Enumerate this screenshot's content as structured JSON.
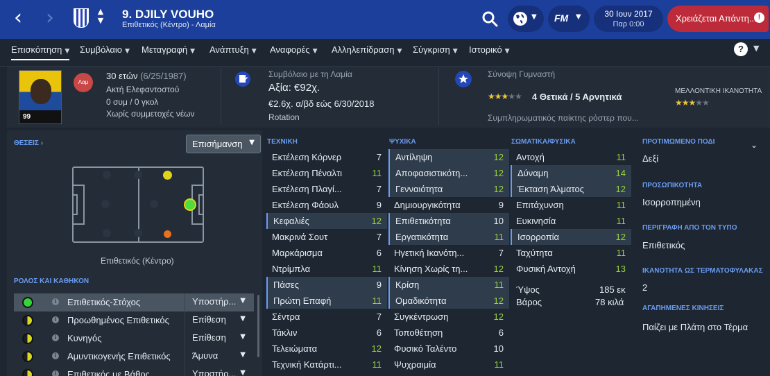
{
  "header": {
    "player_title": "9. DJILY VOUHO",
    "subtitle": "Επιθετικός (Κέντρο) - Λαμία",
    "date": "30 Ιουν 2017",
    "time": "Παρ 0:00",
    "alert": "Χρειάζεται Απάντη...",
    "alert_icon": "!",
    "fm_logo": "FM"
  },
  "nav": {
    "tabs": [
      "Επισκόπηση",
      "Συμβόλαιο",
      "Μεταγραφή",
      "Ανάπτυξη",
      "Αναφορές",
      "Αλληλεπίδραση",
      "Σύγκριση",
      "Ιστορικό"
    ],
    "help": "?"
  },
  "info": {
    "shirt_number": "99",
    "club_short": "Λαμ",
    "age": "30 ετών",
    "dob": "(6/25/1987)",
    "nationality": "Ακτή Ελεφαντοστού",
    "caps": "0 συμ / 0 γκολ",
    "youth": "Χωρίς συμμετοχές νέων",
    "contract_title": "Συμβόλαιο με τη Λαμία",
    "value": "Αξία: €92χ.",
    "wage": "€2.6χ. α/βδ εώς 6/30/2018",
    "squad_status": "Rotation",
    "coach_title": "Σύνοψη Γυμναστή",
    "coach_summary": "4 Θετικά / 5 Αρνητικά",
    "coach_stars": 3,
    "coach_stars_max": 5,
    "coach_desc": "Συμπληρωματικός παίκτης ρόστερ που...",
    "potential_label": "ΜΕΛΛΟΝΤΙΚΗ ΙΚΑΝΟΤΗΤΑ",
    "potential_stars": 3,
    "potential_stars_max": 5
  },
  "positions": {
    "title": "ΘΕΣΕΙΣ",
    "highlight_label": "Επισήμανση",
    "position_label": "Επιθετικός (Κέντρο)",
    "pitch_markers": [
      {
        "role": "natural",
        "color": "#4fdc3f"
      },
      {
        "role": "competent",
        "color": "#e1d21a"
      },
      {
        "role": "unconvincing",
        "color": "#e9701e"
      }
    ]
  },
  "roles": {
    "title": "ΡΟΛΟΣ ΚΑΙ ΚΑΘΗΚΟΝ",
    "items": [
      {
        "name": "Επιθετικός-Στόχος",
        "duty": "Υποστήρ...",
        "rating_color": "#35d53a"
      },
      {
        "name": "Προωθημένος Επιθετικός",
        "duty": "Επίθεση",
        "rating_color": "#d8d81e"
      },
      {
        "name": "Κυνηγός",
        "duty": "Επίθεση",
        "rating_color": "#d8d81e"
      },
      {
        "name": "Αμυντικογενής Επιθετικός",
        "duty": "Άμυνα",
        "rating_color": "#d8d81e"
      },
      {
        "name": "Επιθετικός με Βάθος",
        "duty": "Υποστήρ...",
        "rating_color": "#d8d81e"
      }
    ]
  },
  "technical": {
    "title": "ΤΕΧΝΙΚΗ",
    "items": [
      {
        "name": "Εκτέλεση Κόρνερ",
        "value": "7"
      },
      {
        "name": "Εκτέλεση Πέναλτι",
        "value": "11"
      },
      {
        "name": "Εκτέλεση Πλαγί...",
        "value": "7"
      },
      {
        "name": "Εκτέλεση Φάουλ",
        "value": "9"
      },
      {
        "name": "Κεφαλιές",
        "value": "12"
      },
      {
        "name": "Μακρινά Σουτ",
        "value": "7"
      },
      {
        "name": "Μαρκάρισμα",
        "value": "6"
      },
      {
        "name": "Ντρίμπλα",
        "value": "11"
      },
      {
        "name": "Πάσες",
        "value": "9"
      },
      {
        "name": "Πρώτη Επαφή",
        "value": "11"
      },
      {
        "name": "Σέντρα",
        "value": "7"
      },
      {
        "name": "Τάκλιν",
        "value": "6"
      },
      {
        "name": "Τελειώματα",
        "value": "12"
      },
      {
        "name": "Τεχνική Κατάρτι...",
        "value": "11"
      }
    ]
  },
  "mental": {
    "title": "ΨΥΧΙΚΑ",
    "items": [
      {
        "name": "Αντίληψη",
        "value": "12"
      },
      {
        "name": "Αποφασιστικότη...",
        "value": "12"
      },
      {
        "name": "Γενναιότητα",
        "value": "12"
      },
      {
        "name": "Δημιουργικότητα",
        "value": "9"
      },
      {
        "name": "Επιθετικότητα",
        "value": "10"
      },
      {
        "name": "Εργατικότητα",
        "value": "11"
      },
      {
        "name": "Ηγετική Ικανότη...",
        "value": "7"
      },
      {
        "name": "Κίνηση Χωρίς τη...",
        "value": "12"
      },
      {
        "name": "Κρίση",
        "value": "11"
      },
      {
        "name": "Ομαδικότητα",
        "value": "12"
      },
      {
        "name": "Συγκέντρωση",
        "value": "12"
      },
      {
        "name": "Τοποθέτηση",
        "value": "6"
      },
      {
        "name": "Φυσικό Ταλέντο",
        "value": "10"
      },
      {
        "name": "Ψυχραιμία",
        "value": "11"
      }
    ]
  },
  "physical": {
    "title": "ΣΩΜΑΤΙΚΑ/ΦΥΣΙΚΑ",
    "items": [
      {
        "name": "Αντοχή",
        "value": "11"
      },
      {
        "name": "Δύναμη",
        "value": "14"
      },
      {
        "name": "Έκταση Άλματος",
        "value": "12"
      },
      {
        "name": "Επιτάχυνση",
        "value": "11"
      },
      {
        "name": "Ευκινησία",
        "value": "11"
      },
      {
        "name": "Ισορροπία",
        "value": "12"
      },
      {
        "name": "Ταχύτητα",
        "value": "11"
      },
      {
        "name": "Φυσική Αντοχή",
        "value": "13"
      }
    ],
    "height_label": "Ύψος",
    "height": "185 εκ",
    "weight_label": "Βάρος",
    "weight": "78 κιλά"
  },
  "right": {
    "foot_label": "ΠΡΟΤΙΜΩΜΕΝΟ ΠΟΔΙ",
    "foot": "Δεξί",
    "personality_label": "ΠΡΟΣΩΠΙΚΟΤΗΤΑ",
    "personality": "Ισορροπημένη",
    "media_label": "ΠΕΡΙΓΡΑΦΗ ΑΠΟ ΤΟΝ ΤΥΠΟ",
    "media": "Επιθετικός",
    "gk_label": "ΙΚΑΝΟΤΗΤΑ ΩΣ ΤΕΡΜΑΤΟΦΥΛΑΚΑΣ",
    "gk": "2",
    "moves_label": "ΑΓΑΠΗΜΕΝΕΣ ΚΙΝΗΣΕΙΣ",
    "moves": "Παίζει με Πλάτη στο Τέρμα"
  }
}
